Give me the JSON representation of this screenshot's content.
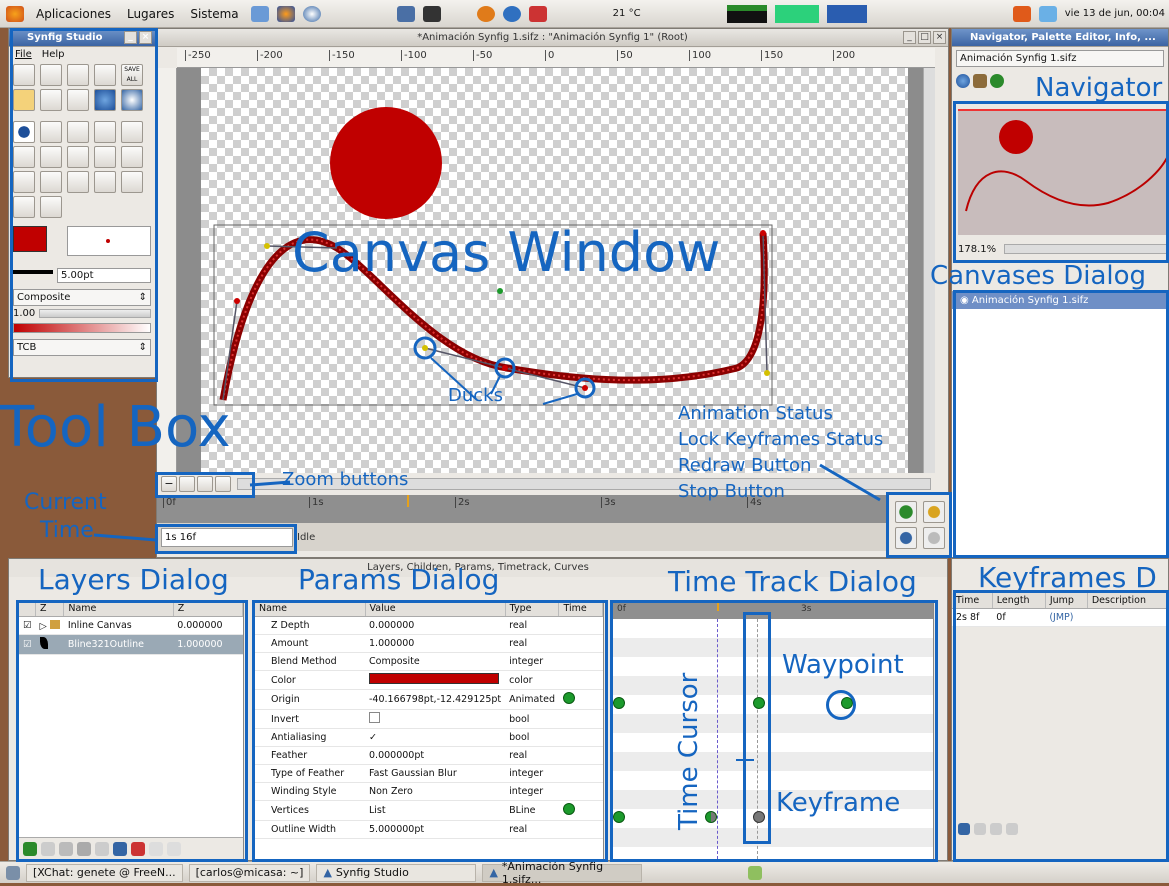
{
  "top_panel": {
    "menus": [
      "Aplicaciones",
      "Lugares",
      "Sistema"
    ],
    "temperature": "21 °C",
    "clock": "vie 13 de jun, 00:04"
  },
  "toolbox": {
    "title": "Synfig Studio",
    "menu": [
      "File",
      "Help"
    ],
    "save_all_label": "SAVE ALL",
    "width_value": "5.00pt",
    "blend_method": "Composite",
    "amount_value": "1.00",
    "interpolation": "TCB",
    "fill_color": "#c00000"
  },
  "canvas_window": {
    "title": "*Animación Synfig 1.sifz : \"Animación Synfig 1\" (Root)",
    "ruler_ticks": [
      "-250",
      "-200",
      "-150",
      "-100",
      "-50",
      "0",
      "50",
      "100",
      "150",
      "200"
    ],
    "time_ticks": [
      "0f",
      "1s",
      "2s",
      "3s",
      "4s"
    ],
    "current_time": "1s 16f",
    "status": "Idle"
  },
  "navigator": {
    "title": "Navigator, Palette Editor, Info, ...",
    "file": "Animación Synfig 1.sifz",
    "zoom": "178.1%"
  },
  "canvases": {
    "item": "Animación Synfig 1.sifz"
  },
  "bottom_panel": {
    "title": "Layers, Children, Params, Timetrack, Curves"
  },
  "layers": {
    "columns": [
      "Z",
      "Name",
      "Z"
    ],
    "rows": [
      {
        "name": "Inline Canvas",
        "z": "0.000000"
      },
      {
        "name": "Bline321Outline",
        "z": "1.000000"
      }
    ]
  },
  "params": {
    "columns": [
      "Name",
      "Value",
      "Type",
      "Time"
    ],
    "rows": [
      {
        "name": "Z Depth",
        "value": "0.000000",
        "type": "real"
      },
      {
        "name": "Amount",
        "value": "1.000000",
        "type": "real"
      },
      {
        "name": "Blend Method",
        "value": "Composite",
        "type": "integer"
      },
      {
        "name": "Color",
        "value": "",
        "type": "color"
      },
      {
        "name": "Origin",
        "value": "-40.166798pt,-12.429125pt",
        "type": "Animated"
      },
      {
        "name": "Invert",
        "value": "",
        "type": "bool"
      },
      {
        "name": "Antialiasing",
        "value": "✓",
        "type": "bool"
      },
      {
        "name": "Feather",
        "value": "0.000000pt",
        "type": "real"
      },
      {
        "name": "Type of Feather",
        "value": "Fast Gaussian Blur",
        "type": "integer"
      },
      {
        "name": "Winding Style",
        "value": "Non Zero",
        "type": "integer"
      },
      {
        "name": "Vertices",
        "value": "List",
        "type": "BLine"
      },
      {
        "name": "Outline Width",
        "value": "5.000000pt",
        "type": "real"
      }
    ]
  },
  "timetrack": {
    "ticks": [
      "0f",
      "3s"
    ]
  },
  "keyframes": {
    "columns": [
      "Time",
      "Length",
      "Jump",
      "Description"
    ],
    "rows": [
      {
        "time": "2s 8f",
        "length": "0f",
        "jump": "(JMP)",
        "description": ""
      }
    ]
  },
  "taskbar": {
    "tasks": [
      "[XChat: genete @ FreeN...",
      "[carlos@micasa: ~]",
      "Synfig Studio",
      "*Animación Synfig 1.sifz..."
    ]
  },
  "annotations": {
    "canvas_window": "Canvas Window",
    "tool_box": "Tool Box",
    "navigator": "Navigator",
    "canvases_dialog": "Canvases Dialog",
    "ducks": "Ducks",
    "animation_status": "Animation Status",
    "lock_keyframes": "Lock Keyframes Status",
    "redraw": "Redraw Button",
    "stop": "Stop Button",
    "zoom_buttons": "Zoom buttons",
    "current_time_1": "Current",
    "current_time_2": "Time",
    "layers_dialog": "Layers Dialog",
    "params_dialog": "Params Dialog",
    "time_track_dialog": "Time Track Dialog",
    "keyframes_dialog": "Keyframes D",
    "time_cursor": "Time Cursor",
    "waypoint": "Waypoint",
    "keyframe": "Keyframe"
  },
  "colors": {
    "annotation_blue": "#1565c0",
    "shape_red": "#c00000",
    "waypoint_green": "#1c9a2c"
  }
}
